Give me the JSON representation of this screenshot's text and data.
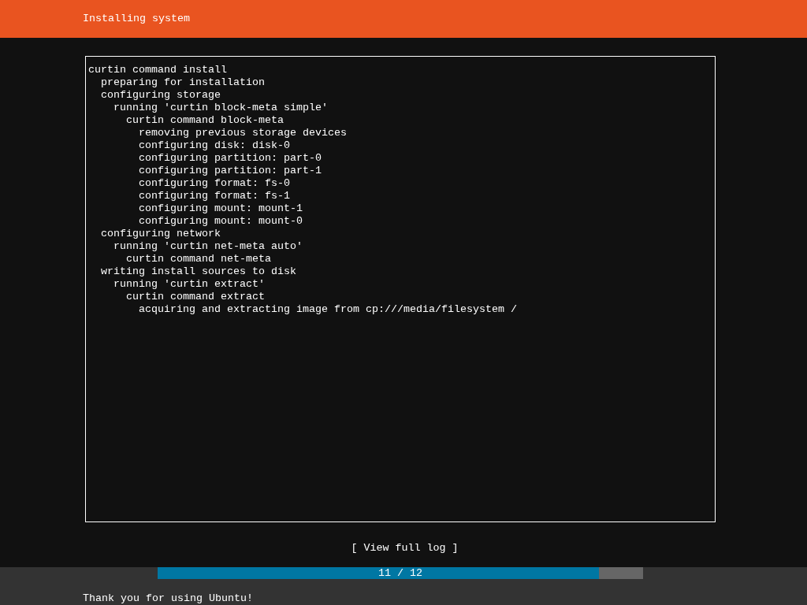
{
  "header": {
    "title": "Installing system"
  },
  "log": [
    {
      "text": "curtin command install",
      "children": [
        {
          "text": "preparing for installation"
        },
        {
          "text": "configuring storage",
          "children": [
            {
              "text": "running 'curtin block-meta simple'",
              "children": [
                {
                  "text": "curtin command block-meta",
                  "children": [
                    {
                      "text": "removing previous storage devices"
                    },
                    {
                      "text": "configuring disk: disk-0"
                    },
                    {
                      "text": "configuring partition: part-0"
                    },
                    {
                      "text": "configuring partition: part-1"
                    },
                    {
                      "text": "configuring format: fs-0"
                    },
                    {
                      "text": "configuring format: fs-1"
                    },
                    {
                      "text": "configuring mount: mount-1"
                    },
                    {
                      "text": "configuring mount: mount-0"
                    }
                  ]
                }
              ]
            }
          ]
        },
        {
          "text": "configuring network",
          "children": [
            {
              "text": "running 'curtin net-meta auto'",
              "children": [
                {
                  "text": "curtin command net-meta"
                }
              ]
            }
          ]
        },
        {
          "text": "writing install sources to disk",
          "children": [
            {
              "text": "running 'curtin extract'",
              "children": [
                {
                  "text": "curtin command extract",
                  "children": [
                    {
                      "text": "acquiring and extracting image from cp:///media/filesystem /"
                    }
                  ]
                }
              ]
            }
          ]
        }
      ]
    }
  ],
  "button": {
    "label": "[ View full log ]"
  },
  "progress": {
    "level": 0.909,
    "reading": "11 / 12"
  },
  "footer": {
    "message": "Thank you for using Ubuntu!"
  }
}
